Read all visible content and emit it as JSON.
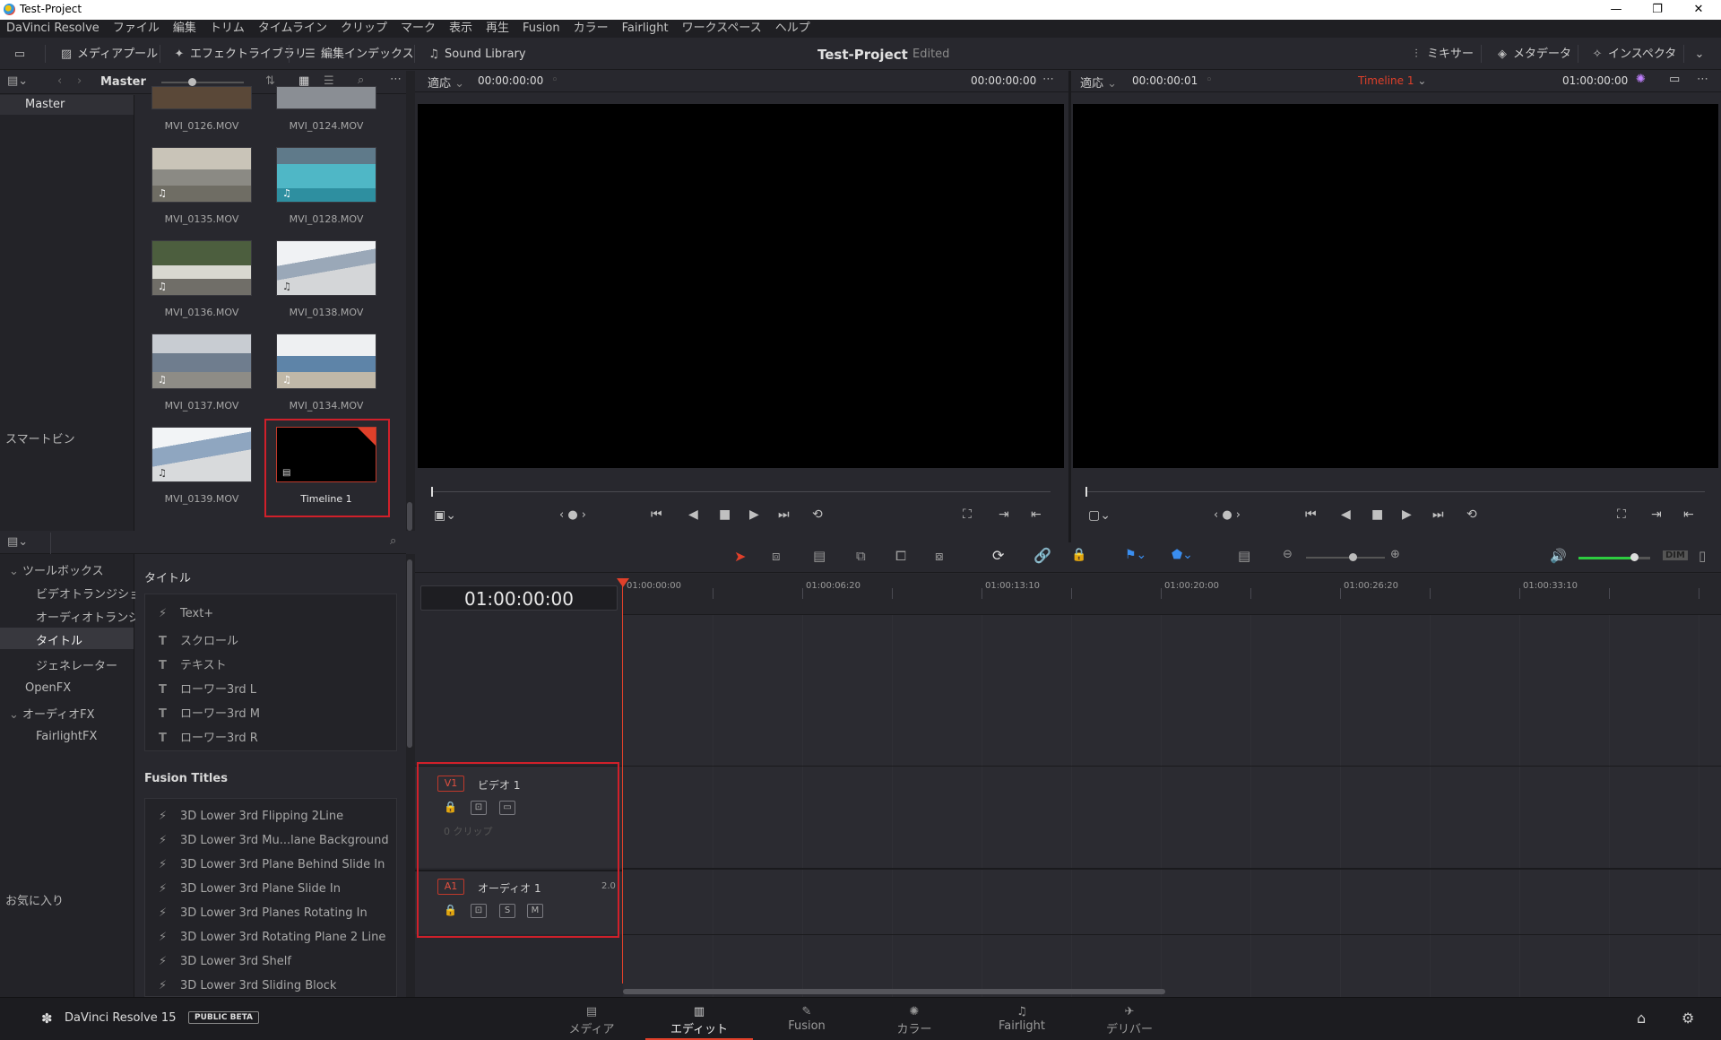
{
  "window": {
    "title": "Test-Project",
    "minimize": "—",
    "maximize": "❐",
    "close": "✕"
  },
  "menu": [
    "DaVinci Resolve",
    "ファイル",
    "編集",
    "トリム",
    "タイムライン",
    "クリップ",
    "マーク",
    "表示",
    "再生",
    "Fusion",
    "カラー",
    "Fairlight",
    "ワークスペース",
    "ヘルプ"
  ],
  "toolbar": {
    "media_pool": "メディアプール",
    "effects_library": "エフェクトライブラリ",
    "edit_index": "編集インデックス",
    "sound_library": "Sound Library",
    "project_title": "Test-Project",
    "status": "Edited",
    "mixer": "ミキサー",
    "metadata": "メタデータ",
    "inspector": "インスペクタ"
  },
  "media_pool": {
    "bin_header": "Master",
    "bins": {
      "master": "Master",
      "smart_bins": "スマートビン"
    },
    "clips": [
      {
        "name": "MVI_0126.MOV"
      },
      {
        "name": "MVI_0124.MOV"
      },
      {
        "name": "MVI_0135.MOV"
      },
      {
        "name": "MVI_0128.MOV"
      },
      {
        "name": "MVI_0136.MOV"
      },
      {
        "name": "MVI_0138.MOV"
      },
      {
        "name": "MVI_0137.MOV"
      },
      {
        "name": "MVI_0134.MOV"
      },
      {
        "name": "MVI_0139.MOV"
      },
      {
        "name": "Timeline 1"
      }
    ]
  },
  "effects": {
    "tree": {
      "toolbox": "ツールボックス",
      "video_transitions": "ビデオトランジション",
      "audio_transitions": "オーディオトランジ...",
      "titles": "タイトル",
      "generators": "ジェネレーター",
      "openfx": "OpenFX",
      "audio_fx": "オーディオFX",
      "fairlight_fx": "FairlightFX",
      "favorites": "お気に入り"
    },
    "titles_header": "タイトル",
    "titles": [
      "Text+",
      "スクロール",
      "テキスト",
      "ローワー3rd L",
      "ローワー3rd M",
      "ローワー3rd R"
    ],
    "fusion_header": "Fusion Titles",
    "fusion_titles": [
      "3D Lower 3rd Flipping 2Line",
      "3D Lower 3rd Mu...lane Background",
      "3D Lower 3rd Plane Behind Slide In",
      "3D Lower 3rd Plane Slide In",
      "3D Lower 3rd Planes Rotating In",
      "3D Lower 3rd Rotating Plane 2 Line",
      "3D Lower 3rd Shelf",
      "3D Lower 3rd Sliding Block"
    ]
  },
  "source_viewer": {
    "zoom": "適応",
    "timecode_left": "00:00:00:00",
    "timecode_right": "00:00:00:00"
  },
  "timeline_viewer": {
    "zoom": "適応",
    "timecode_left": "00:00:00:01",
    "timeline_name": "Timeline 1",
    "timecode_right": "01:00:00:00"
  },
  "timeline": {
    "current_timecode": "01:00:00:00",
    "ruler": [
      "01:00:00:00",
      "01:00:06:20",
      "01:00:13:10",
      "01:00:20:00",
      "01:00:26:20",
      "01:00:33:10"
    ],
    "tracks": {
      "video": {
        "badge": "V1",
        "name": "ビデオ 1",
        "clips": "0 クリップ"
      },
      "audio": {
        "badge": "A1",
        "name": "オーディオ 1",
        "channels": "2.0",
        "solo": "S",
        "mute": "M"
      }
    },
    "dim": "DIM"
  },
  "footer": {
    "app": "DaVinci Resolve 15",
    "badge": "PUBLIC BETA",
    "pages": [
      "メディア",
      "エディット",
      "Fusion",
      "カラー",
      "Fairlight",
      "デリバー"
    ],
    "active_page": "エディット"
  },
  "colors": {
    "accent_red": "#e0402a",
    "highlight_box": "#d0202a",
    "audio_level": "#2ecc40"
  }
}
